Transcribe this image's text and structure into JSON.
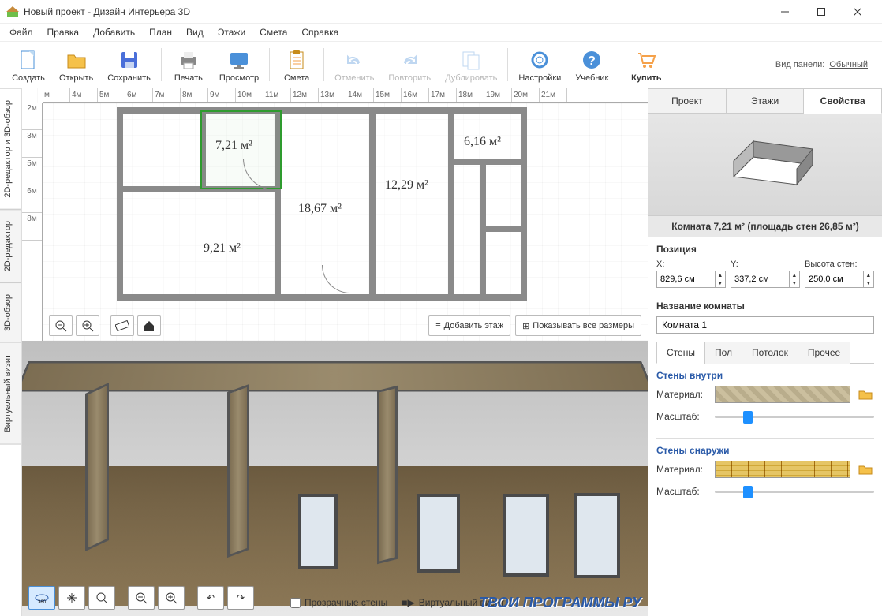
{
  "window": {
    "title": "Новый проект - Дизайн Интерьера 3D"
  },
  "menu": [
    "Файл",
    "Правка",
    "Добавить",
    "План",
    "Вид",
    "Этажи",
    "Смета",
    "Справка"
  ],
  "toolbar": {
    "create": "Создать",
    "open": "Открыть",
    "save": "Сохранить",
    "print": "Печать",
    "preview": "Просмотр",
    "estimate": "Смета",
    "undo": "Отменить",
    "redo": "Повторить",
    "duplicate": "Дублировать",
    "settings": "Настройки",
    "tutorial": "Учебник",
    "buy": "Купить"
  },
  "panelMode": {
    "label": "Вид панели:",
    "value": "Обычный"
  },
  "leftTabs": {
    "combo": "2D-редактор и 3D-обзор",
    "editor": "2D-редактор",
    "view": "3D-обзор",
    "tour": "Виртуальный визит"
  },
  "rulerH": [
    "м",
    "4м",
    "5м",
    "6м",
    "7м",
    "8м",
    "9м",
    "10м",
    "11м",
    "12м",
    "13м",
    "14м",
    "15м",
    "16м",
    "17м",
    "18м",
    "19м",
    "20м",
    "21м"
  ],
  "rulerV": [
    "2м",
    "3м",
    "5м",
    "6м",
    "8м"
  ],
  "rooms": {
    "r1": "7,21 м²",
    "r2": "18,67 м²",
    "r3": "12,29 м²",
    "r4": "6,16 м²",
    "r5": "9,21 м²"
  },
  "planActions": {
    "addFloor": "Добавить этаж",
    "showDims": "Показывать все размеры"
  },
  "view3d": {
    "transparent": "Прозрачные стены",
    "tour": "Виртуальный визит"
  },
  "watermark": "ТВОИ ПРОГРАММЫ РУ",
  "rightTabs": {
    "project": "Проект",
    "floors": "Этажи",
    "props": "Свойства"
  },
  "roomInfo": "Комната 7,21 м²  (площадь стен 26,85 м²)",
  "position": {
    "header": "Позиция",
    "xLabel": "X:",
    "x": "829,6 см",
    "yLabel": "Y:",
    "y": "337,2 см",
    "hLabel": "Высота стен:",
    "h": "250,0 см"
  },
  "roomName": {
    "header": "Название комнаты",
    "value": "Комната 1"
  },
  "subTabs": {
    "walls": "Стены",
    "floor": "Пол",
    "ceiling": "Потолок",
    "other": "Прочее"
  },
  "wallsInner": {
    "title": "Стены внутри",
    "material": "Материал:",
    "scale": "Масштаб:"
  },
  "wallsOuter": {
    "title": "Стены снаружи",
    "material": "Материал:",
    "scale": "Масштаб:"
  }
}
